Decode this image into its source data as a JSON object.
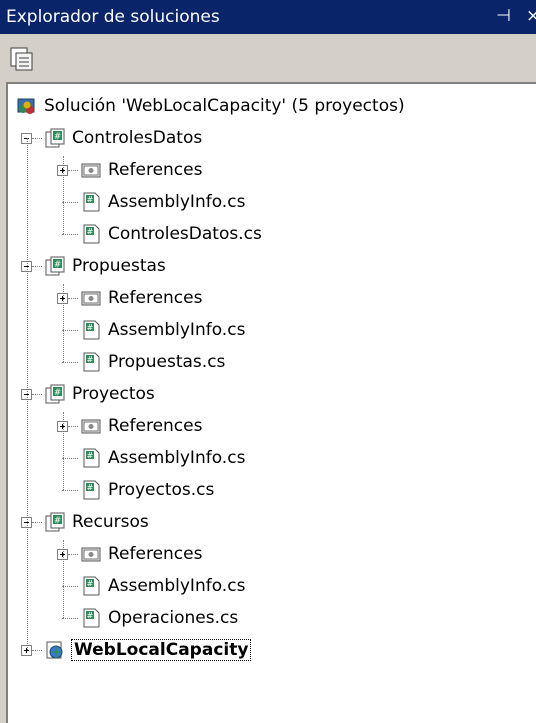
{
  "panel": {
    "title": "Explorador de soluciones"
  },
  "solution": {
    "label": "Solución 'WebLocalCapacity' (5 proyectos)"
  },
  "projects": [
    {
      "name": "ControlesDatos",
      "references": "References",
      "files": [
        "AssemblyInfo.cs",
        "ControlesDatos.cs"
      ]
    },
    {
      "name": "Propuestas",
      "references": "References",
      "files": [
        "AssemblyInfo.cs",
        "Propuestas.cs"
      ]
    },
    {
      "name": "Proyectos",
      "references": "References",
      "files": [
        "AssemblyInfo.cs",
        "Proyectos.cs"
      ]
    },
    {
      "name": "Recursos",
      "references": "References",
      "files": [
        "AssemblyInfo.cs",
        "Operaciones.cs"
      ]
    }
  ],
  "web_project": {
    "name": "WebLocalCapacity"
  },
  "colors": {
    "titlebar": "#0a246a",
    "panel": "#d4d0c8",
    "tree": "#ffffff"
  }
}
